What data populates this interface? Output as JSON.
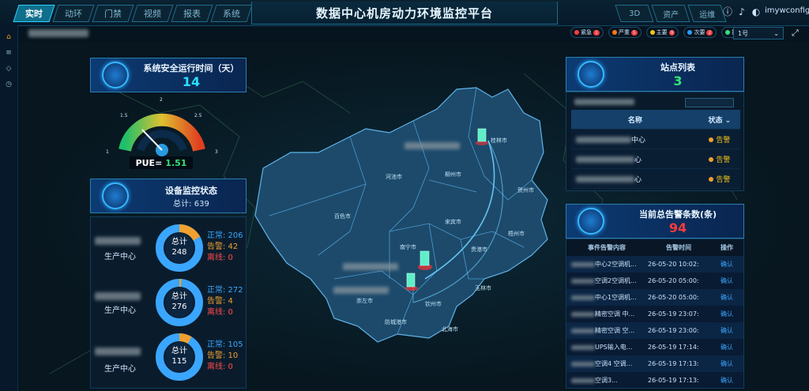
{
  "header": {
    "title": "数据中心机房动力环境监控平台",
    "left_tabs": [
      "实时",
      "动环",
      "门禁",
      "视频",
      "报表",
      "系统"
    ],
    "right_tabs": [
      "3D",
      "资产",
      "运维"
    ],
    "username": "imywconfig"
  },
  "filters": {
    "levels": [
      {
        "label": "紧急",
        "color": "#ff3b3b",
        "count": "1"
      },
      {
        "label": "严重",
        "color": "#ff7a1a",
        "count": "5"
      },
      {
        "label": "主要",
        "color": "#f0c419",
        "count": "9"
      },
      {
        "label": "次要",
        "color": "#2d9bff",
        "count": "2"
      },
      {
        "label": "提示",
        "color": "#36e07a",
        "count": "8"
      }
    ],
    "select_value": "1号"
  },
  "uptime": {
    "title": "系统安全运行时间（天）",
    "value": "14"
  },
  "pue": {
    "label": "PUE=",
    "value": "1.51",
    "ticks": [
      "1",
      "1.5",
      "2",
      "2.5",
      "3"
    ],
    "level": 0.255
  },
  "devices": {
    "title": "设备监控状态",
    "total_text": "总计: 639",
    "groups": [
      {
        "name": "生产中心",
        "total_label": "总计",
        "total": "248",
        "normal": "正常: 206",
        "warn": "告警: 42",
        "offline": "离线: 0"
      },
      {
        "name": "生产中心",
        "total_label": "总计",
        "total": "276",
        "normal": "正常: 272",
        "warn": "告警: 4",
        "offline": "离线: 0"
      },
      {
        "name": "生产中心",
        "total_label": "总计",
        "total": "115",
        "normal": "正常: 105",
        "warn": "告警: 10",
        "offline": "离线: 0"
      }
    ]
  },
  "map": {
    "cities": [
      "桂林市",
      "河池市",
      "柳州市",
      "贺州市",
      "百色市",
      "来宾市",
      "梧州市",
      "南宁市",
      "贵港市",
      "玉林市",
      "崇左市",
      "钦州市",
      "防城港市",
      "北海市"
    ]
  },
  "sites": {
    "title": "站点列表",
    "count": "3",
    "columns": [
      "名称",
      "状态 ⌄"
    ],
    "rows": [
      {
        "name": "中心",
        "status": "告警"
      },
      {
        "name": "心",
        "status": "告警"
      },
      {
        "name": "心",
        "status": "告警"
      }
    ]
  },
  "alarms": {
    "title": "当前总告警条数(条)",
    "count": "94",
    "columns": [
      "事件告警内容",
      "告警时间",
      "操作"
    ],
    "rows": [
      {
        "content": "中心2空调机...",
        "time": "26-05-20 10:02:",
        "op": "确认"
      },
      {
        "content": "空调2空调机...",
        "time": "26-05-20 05:00:",
        "op": "确认"
      },
      {
        "content": "中心1空调机...",
        "time": "26-05-20 05:00:",
        "op": "确认"
      },
      {
        "content": "精密空调 中...",
        "time": "26-05-19 23:07:",
        "op": "确认"
      },
      {
        "content": "精密空调 空...",
        "time": "26-05-19 23:00:",
        "op": "确认"
      },
      {
        "content": "UPS输入电...",
        "time": "26-05-19 17:14:",
        "op": "确认"
      },
      {
        "content": "空调4 空调...",
        "time": "26-05-19 17:13:",
        "op": "确认"
      },
      {
        "content": "空调3...",
        "time": "26-05-19 17:13:",
        "op": "确认"
      }
    ]
  }
}
